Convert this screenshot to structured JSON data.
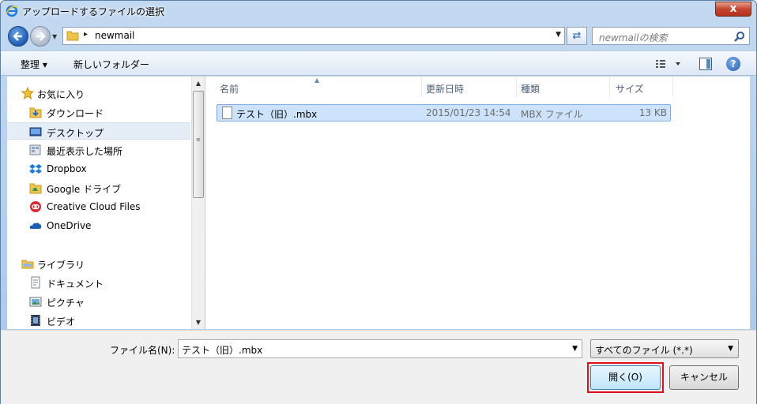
{
  "window": {
    "title": "アップロードするファイルの選択",
    "close_label": "x"
  },
  "address": {
    "path": "newmail",
    "separator": "▸"
  },
  "search": {
    "placeholder": "newmailの検索"
  },
  "toolbar": {
    "organize_label": "整理 ▾",
    "new_folder_label": "新しいフォルダー",
    "help_label": "?"
  },
  "sidebar": {
    "favorites": {
      "label": "お気に入り",
      "items": [
        {
          "label": "ダウンロード",
          "icon": "download-folder-icon"
        },
        {
          "label": "デスクトップ",
          "icon": "desktop-icon",
          "selected": true
        },
        {
          "label": "最近表示した場所",
          "icon": "recent-places-icon"
        },
        {
          "label": "Dropbox",
          "icon": "dropbox-icon"
        },
        {
          "label": "Google ドライブ",
          "icon": "google-drive-icon"
        },
        {
          "label": "Creative Cloud Files",
          "icon": "creative-cloud-icon"
        },
        {
          "label": "OneDrive",
          "icon": "onedrive-icon"
        }
      ]
    },
    "libraries": {
      "label": "ライブラリ",
      "items": [
        {
          "label": "ドキュメント",
          "icon": "documents-icon"
        },
        {
          "label": "ピクチャ",
          "icon": "pictures-icon"
        },
        {
          "label": "ビデオ",
          "icon": "videos-icon"
        }
      ]
    }
  },
  "file_list": {
    "columns": [
      "名前",
      "更新日時",
      "種類",
      "サイズ"
    ],
    "rows": [
      {
        "name": "テスト（旧）.mbx",
        "modified": "2015/01/23 14:54",
        "type": "MBX ファイル",
        "size": "13 KB",
        "selected": true
      }
    ]
  },
  "footer": {
    "filename_label": "ファイル名(N):",
    "filename_value": "テスト（旧）.mbx",
    "filter_value": "すべてのファイル (*.*)",
    "open_label": "開く(O)",
    "cancel_label": "キャンセル"
  },
  "colors": {
    "accent": "#e0101a",
    "selection": "#cde3fb",
    "frame": "#a8c6ea"
  }
}
